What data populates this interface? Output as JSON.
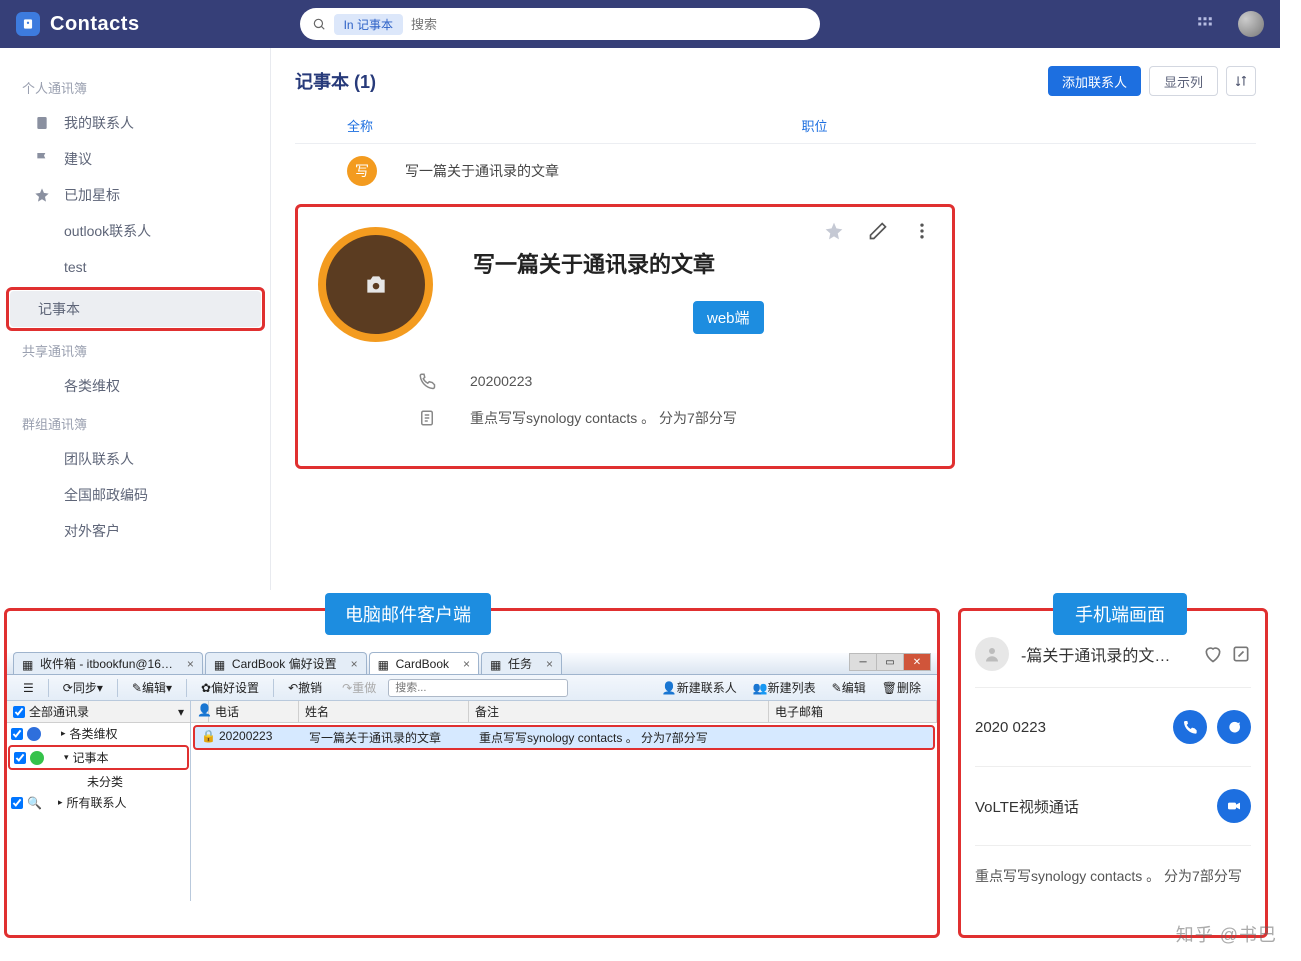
{
  "web": {
    "app_title": "Contacts",
    "search": {
      "scope_prefix": "In",
      "scope": "记事本",
      "placeholder": "搜索"
    },
    "sidebar": {
      "groups": [
        {
          "label": "个人通讯簿",
          "items": [
            {
              "icon": "contacts",
              "label": "我的联系人"
            },
            {
              "icon": "flag",
              "label": "建议"
            },
            {
              "icon": "star",
              "label": "已加星标"
            },
            {
              "plain": true,
              "label": "outlook联系人"
            },
            {
              "plain": true,
              "label": "test"
            },
            {
              "plain": true,
              "selected": true,
              "framed": true,
              "label": "记事本"
            }
          ]
        },
        {
          "label": "共享通讯簿",
          "items": [
            {
              "plain": true,
              "label": "各类维权"
            }
          ]
        },
        {
          "label": "群组通讯簿",
          "items": [
            {
              "plain": true,
              "label": "团队联系人"
            },
            {
              "plain": true,
              "label": "全国邮政编码"
            },
            {
              "plain": true,
              "label": "对外客户"
            }
          ]
        }
      ]
    },
    "main": {
      "heading": "记事本 (1)",
      "buttons": {
        "add": "添加联系人",
        "cols": "显示列"
      },
      "columns": {
        "name": "全称",
        "job": "职位"
      },
      "row": {
        "initial": "写",
        "title": "写一篇关于通讯录的文章"
      },
      "card": {
        "title": "写一篇关于通讯录的文章",
        "tag": "web端",
        "phone": "20200223",
        "note": "重点写写synology contacts 。 分为7部分写"
      }
    }
  },
  "tb": {
    "label": "电脑邮件客户端",
    "tabs": [
      {
        "text": "收件箱 - itbookfun@16…"
      },
      {
        "text": "CardBook 偏好设置"
      },
      {
        "text": "CardBook",
        "selected": true
      },
      {
        "text": "任务"
      }
    ],
    "toolbar": {
      "sync": "同步",
      "edit": "编辑",
      "pref": "偏好设置",
      "undo": "撤销",
      "redo": "重做",
      "search_placeholder": "搜索...",
      "new_contact": "新建联系人",
      "new_list": "新建列表",
      "edit2": "编辑",
      "del": "删除"
    },
    "tree_header": "全部通讯录",
    "tree": [
      {
        "color": "blue",
        "label": "各类维权"
      },
      {
        "color": "green",
        "label": "记事本",
        "framed": true
      },
      {
        "indent": true,
        "label": "未分类"
      },
      {
        "search": true,
        "label": "所有联系人"
      }
    ],
    "table": {
      "headers": {
        "phone": "电话",
        "name": "姓名",
        "note": "备注",
        "email": "电子邮箱"
      },
      "row": {
        "phone": "20200223",
        "name": "写一篇关于通讯录的文章",
        "note": "重点写写synology contacts 。 分为7部分写"
      }
    }
  },
  "mb": {
    "label": "手机端画面",
    "title": "-篇关于通讯录的文…",
    "rows": [
      {
        "text": "2020 0223",
        "buttons": [
          "phone",
          "chat"
        ]
      },
      {
        "text": "VoLTE视频通话",
        "buttons": [
          "video"
        ]
      }
    ],
    "note": "重点写写synology contacts 。 分为7部分写"
  },
  "watermark": "知乎 @书巴"
}
